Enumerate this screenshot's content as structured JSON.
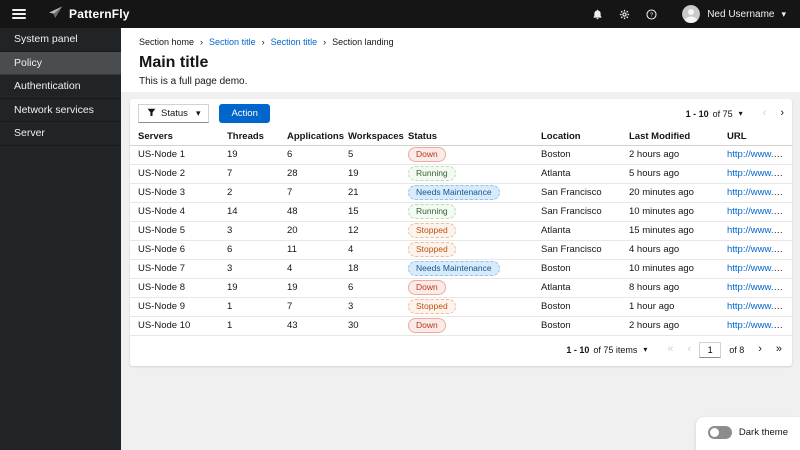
{
  "masthead": {
    "logo_text": "PatternFly",
    "user_name": "Ned Username"
  },
  "sidebar": {
    "items": [
      {
        "label": "System panel",
        "selected": false
      },
      {
        "label": "Policy",
        "selected": true
      },
      {
        "label": "Authentication",
        "selected": false
      },
      {
        "label": "Network services",
        "selected": false
      },
      {
        "label": "Server",
        "selected": false
      }
    ]
  },
  "breadcrumb": {
    "items": [
      {
        "label": "Section home",
        "type": "text"
      },
      {
        "label": "Section title",
        "type": "link"
      },
      {
        "label": "Section title",
        "type": "link"
      },
      {
        "label": "Section landing",
        "type": "current"
      }
    ]
  },
  "page": {
    "title": "Main title",
    "subtitle": "This is a full page demo."
  },
  "toolbar": {
    "filter_label": "Status",
    "action_label": "Action"
  },
  "pagination_top": {
    "range": "1 - 10",
    "of": "of 75"
  },
  "pagination_bottom": {
    "range": "1 - 10",
    "of": "of 75 items",
    "page": "1",
    "of_pages": "of 8"
  },
  "table": {
    "columns": [
      "Servers",
      "Threads",
      "Applications",
      "Workspaces",
      "Status",
      "Location",
      "Last Modified",
      "URL"
    ],
    "rows": [
      {
        "server": "US-Node 1",
        "threads": "19",
        "applications": "6",
        "workspaces": "5",
        "status": "Down",
        "variant": "red",
        "location": "Boston",
        "modified": "2 hours ago",
        "url": "http://www.redhat..."
      },
      {
        "server": "US-Node 2",
        "threads": "7",
        "applications": "28",
        "workspaces": "19",
        "status": "Running",
        "variant": "green",
        "location": "Atlanta",
        "modified": "5 hours ago",
        "url": "http://www.redhat..."
      },
      {
        "server": "US-Node 3",
        "threads": "2",
        "applications": "7",
        "workspaces": "21",
        "status": "Needs Maintenance",
        "variant": "blue",
        "location": "San Francisco",
        "modified": "20 minutes ago",
        "url": "http://www.redhat..."
      },
      {
        "server": "US-Node 4",
        "threads": "14",
        "applications": "48",
        "workspaces": "15",
        "status": "Running",
        "variant": "green",
        "location": "San Francisco",
        "modified": "10 minutes ago",
        "url": "http://www.redhat..."
      },
      {
        "server": "US-Node 5",
        "threads": "3",
        "applications": "20",
        "workspaces": "12",
        "status": "Stopped",
        "variant": "orange",
        "location": "Atlanta",
        "modified": "15 minutes ago",
        "url": "http://www.redhat..."
      },
      {
        "server": "US-Node 6",
        "threads": "6",
        "applications": "11",
        "workspaces": "4",
        "status": "Stopped",
        "variant": "orange",
        "location": "San Francisco",
        "modified": "4 hours ago",
        "url": "http://www.redhat..."
      },
      {
        "server": "US-Node 7",
        "threads": "3",
        "applications": "4",
        "workspaces": "18",
        "status": "Needs Maintenance",
        "variant": "blue",
        "location": "Boston",
        "modified": "10 minutes ago",
        "url": "http://www.redhat..."
      },
      {
        "server": "US-Node 8",
        "threads": "19",
        "applications": "19",
        "workspaces": "6",
        "status": "Down",
        "variant": "red",
        "location": "Atlanta",
        "modified": "8 hours ago",
        "url": "http://www.redhat..."
      },
      {
        "server": "US-Node 9",
        "threads": "1",
        "applications": "7",
        "workspaces": "3",
        "status": "Stopped",
        "variant": "orange",
        "location": "Boston",
        "modified": "1 hour ago",
        "url": "http://www.redhat..."
      },
      {
        "server": "US-Node 10",
        "threads": "1",
        "applications": "43",
        "workspaces": "30",
        "status": "Down",
        "variant": "red",
        "location": "Boston",
        "modified": "2 hours ago",
        "url": "http://www.redhat..."
      }
    ]
  },
  "theme_switch": {
    "label": "Dark theme"
  },
  "glyphs": {
    "caret_down": "▾",
    "chevron_left": "‹",
    "chevron_right": "›",
    "chevron_first": "«",
    "chevron_last": "»",
    "breadcrumb_sep": "›"
  },
  "icons": {
    "menu": "hamburger",
    "notifications": "bell",
    "settings": "gear",
    "help": "question-circle",
    "user": "avatar",
    "filter": "funnel"
  },
  "colors": {
    "primary": "#0066cc",
    "masthead_bg": "#151515",
    "sidebar_bg": "#212427",
    "sidebar_selected_bg": "#4a4d50",
    "page_bg": "#f0f0f0",
    "card_bg": "#ffffff",
    "link": "#0066cc",
    "status_red": "#c0341d",
    "status_green": "#3a5e33",
    "status_blue": "#155591",
    "status_orange": "#bc5210"
  }
}
